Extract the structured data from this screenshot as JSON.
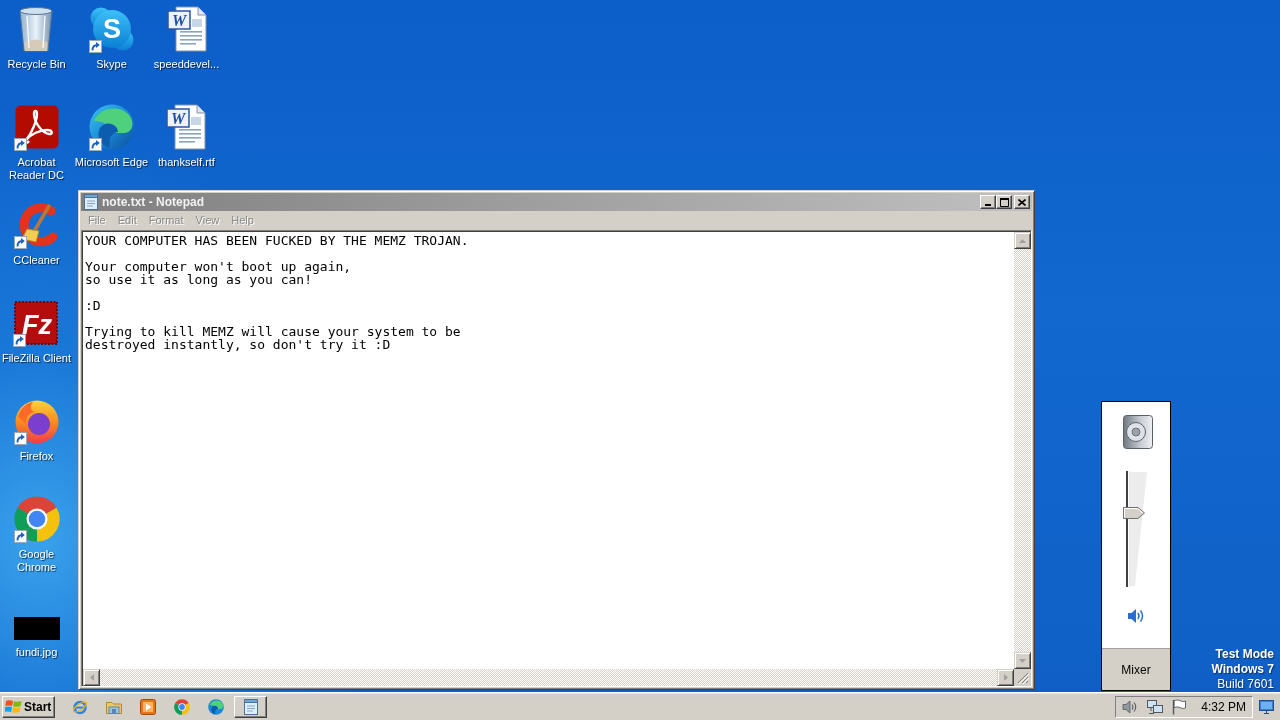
{
  "desktop": {
    "columns": [
      {
        "items": [
          {
            "label": "Recycle Bin",
            "kind": "recycle-bin",
            "shortcut": false
          },
          {
            "label": "Acrobat Reader DC",
            "kind": "acrobat",
            "shortcut": true
          },
          {
            "label": "CCleaner",
            "kind": "ccleaner",
            "shortcut": true
          },
          {
            "label": "FileZilla Client",
            "kind": "filezilla",
            "shortcut": true,
            "glyph": "Fz"
          },
          {
            "label": "Firefox",
            "kind": "firefox",
            "shortcut": true
          },
          {
            "label": "Google Chrome",
            "kind": "chrome",
            "shortcut": true
          },
          {
            "label": "fundi.jpg",
            "kind": "image",
            "shortcut": false
          }
        ]
      },
      {
        "items": [
          {
            "label": "Skype",
            "kind": "skype",
            "shortcut": true,
            "glyph": "S"
          },
          {
            "label": "Microsoft Edge",
            "kind": "edge",
            "shortcut": true
          }
        ]
      },
      {
        "items": [
          {
            "label": "speeddevel...",
            "kind": "word",
            "shortcut": false,
            "glyph": "W"
          },
          {
            "label": "thankself.rtf",
            "kind": "word",
            "shortcut": false,
            "glyph": "W"
          }
        ]
      }
    ]
  },
  "notepad": {
    "title": "note.txt - Notepad",
    "menu": [
      {
        "label": "File",
        "disabled": true
      },
      {
        "label": "Edit",
        "disabled": true
      },
      {
        "label": "Format",
        "disabled": true
      },
      {
        "label": "View",
        "disabled": true
      },
      {
        "label": "Help",
        "disabled": true
      }
    ],
    "text": "YOUR COMPUTER HAS BEEN FUCKED BY THE MEMZ TROJAN.\n\nYour computer won't boot up again,\nso use it as long as you can!\n\n:D\n\nTrying to kill MEMZ will cause your system to be\ndestroyed instantly, so don't try it :D"
  },
  "volume_popup": {
    "level": 0.65,
    "muted": false,
    "button": "Mixer"
  },
  "desktop_notice": {
    "mode": "Test Mode",
    "edition": "Windows 7",
    "build": "Build 7601"
  },
  "taskbar": {
    "start": "Start",
    "clock": "4:32 PM"
  }
}
